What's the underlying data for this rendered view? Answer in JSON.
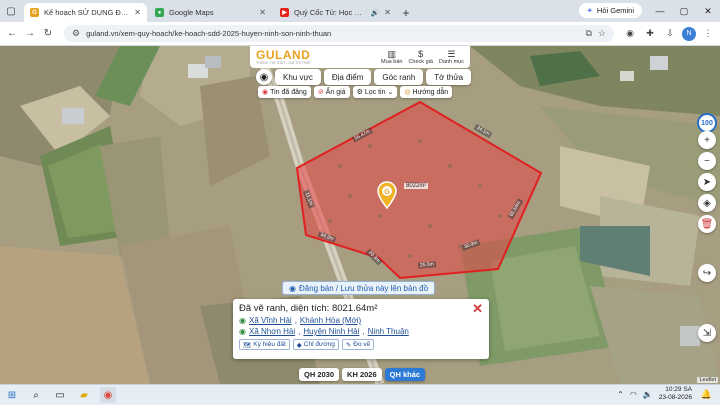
{
  "browser": {
    "tabs": [
      {
        "title": "Kế hoạch SỬ DỤNG ĐẤT 2025...",
        "favicon_color": "#e8a21f",
        "active": true
      },
      {
        "title": "Google Maps",
        "favicon_color": "#34a853",
        "active": false
      },
      {
        "title": "Quỷ Cốc Tử: Học Cách Cân...",
        "favicon_color": "#e62117",
        "active": false
      }
    ],
    "gemini_label": "Hỏi Gemini",
    "url": "guland.vn/xem-quy-hoach/ke-hoach-sdd-2025-huyen-ninh-son-ninh-thuan"
  },
  "site": {
    "logo": "GULAND",
    "logo_tagline": "THÔNG TIN THẬT - GIÁ TRỊ THẬT",
    "top_buttons": [
      {
        "label": "Mua bán",
        "icon": "building-icon"
      },
      {
        "label": "Check giá",
        "icon": "dollar-icon"
      },
      {
        "label": "Danh mục",
        "icon": "menu-icon"
      }
    ],
    "filter_tabs": [
      "Khu vực",
      "Địa điểm",
      "Góc ranh",
      "Tờ thửa"
    ],
    "filter_row2": [
      "Tin đã đăng",
      "Ẩn giá",
      "Lọc tin",
      "Hướng dẫn"
    ]
  },
  "map": {
    "zoom_badge": "100",
    "area_tag": "8022m²",
    "edge_labels": [
      "55.47m",
      "34.1m",
      "65.54m",
      "11.1m",
      "34.2m",
      "20.4m",
      "25.5m",
      "30.9m",
      "45.4m",
      "39.5m",
      "37.1m",
      "18.2m"
    ],
    "register_banner": "Đăng bán / Lưu thửa này lên bản đồ",
    "plan_tabs": [
      {
        "label": "QH 2030",
        "active": false
      },
      {
        "label": "KH 2026",
        "active": false
      },
      {
        "label": "QH khác",
        "active": true
      }
    ],
    "attribution": "Leaflet",
    "boundary_color": "#e02020"
  },
  "info_card": {
    "heading": "Đã vẽ ranh, diện tích: 8021.64m²",
    "location_1": [
      "Xã Vĩnh Hải",
      "Khánh Hòa (Mới)"
    ],
    "location_2": [
      "Xã Nhơn Hải",
      "Huyện Ninh Hải",
      "Ninh Thuận"
    ],
    "actions": [
      "Ký hiệu đất",
      "Chỉ đường",
      "Đo vẽ"
    ]
  },
  "taskbar": {
    "time": "10:29 SA",
    "date": "23-08-2026"
  }
}
